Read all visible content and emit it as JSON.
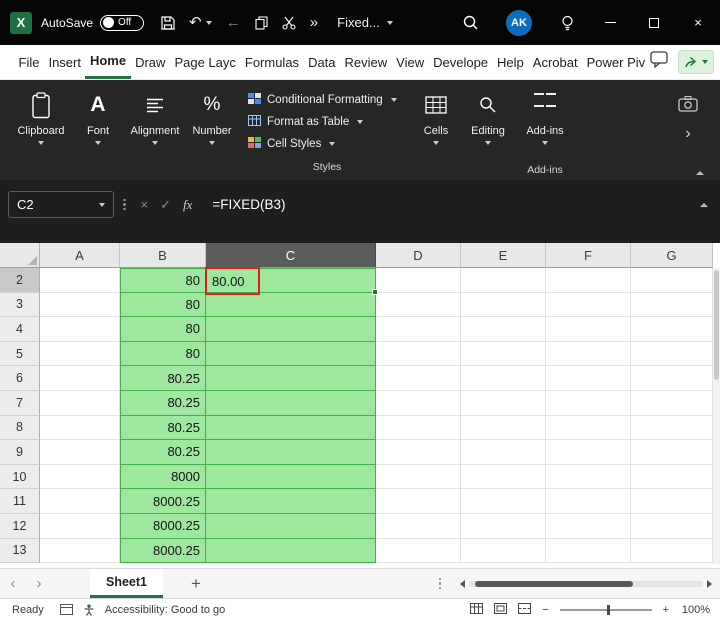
{
  "title_bar": {
    "autosave_label": "AutoSave",
    "autosave_state": "Off",
    "doc_dropdown": "Fixed...",
    "avatar": "AK"
  },
  "menu_bar": {
    "items": [
      "File",
      "Insert",
      "Home",
      "Draw",
      "Page Layc",
      "Formulas",
      "Data",
      "Review",
      "View",
      "Develope",
      "Help",
      "Acrobat",
      "Power Piv"
    ],
    "active_item": "Home"
  },
  "ribbon": {
    "big_groups": [
      {
        "label": "Clipboard"
      },
      {
        "label": "Font"
      },
      {
        "label": "Alignment"
      },
      {
        "label": "Number"
      }
    ],
    "styles_group": {
      "items": [
        "Conditional Formatting",
        "Format as Table",
        "Cell Styles"
      ],
      "group_label": "Styles"
    },
    "cells_label": "Cells",
    "editing_label": "Editing",
    "addins": {
      "label": "Add-ins",
      "group_label": "Add-ins"
    }
  },
  "formula_bar": {
    "name_box": "C2",
    "cancel": "×",
    "enter": "✓",
    "fx": "fx",
    "formula": "=FIXED(B3)"
  },
  "grid": {
    "columns": [
      "A",
      "B",
      "C",
      "D",
      "E",
      "F",
      "G"
    ],
    "selected_column": "C",
    "rows": [
      "2",
      "3",
      "4",
      "5",
      "6",
      "7",
      "8",
      "9",
      "10",
      "11",
      "12",
      "13"
    ],
    "b_values": [
      "80",
      "80",
      "80",
      "80",
      "80.25",
      "80.25",
      "80.25",
      "80.25",
      "8000",
      "8000.25",
      "8000.25",
      "8000.25"
    ],
    "c2_value": "80.00"
  },
  "sheet_bar": {
    "active_tab": "Sheet1"
  },
  "status_bar": {
    "ready": "Ready",
    "accessibility": "Accessibility: Good to go",
    "zoom": "100%"
  },
  "colors": {
    "accent_green": "#217346",
    "cell_green": "#9fe69f",
    "cell_green_border": "#43b049",
    "highlight_red": "#e01f1f",
    "addins_orange": "#d83b01",
    "avatar_blue": "#0f6cbd"
  }
}
